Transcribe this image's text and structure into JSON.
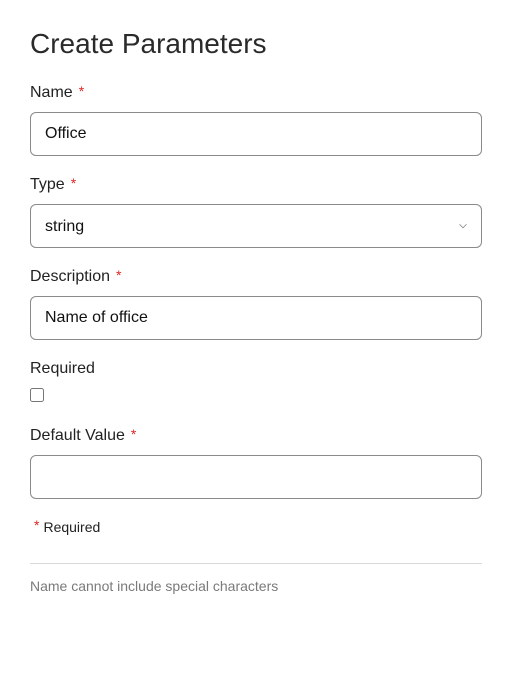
{
  "title": "Create Parameters",
  "required_marker": "*",
  "fields": {
    "name": {
      "label": "Name",
      "value": "Office",
      "required": true
    },
    "type": {
      "label": "Type",
      "value": "string",
      "required": true
    },
    "description": {
      "label": "Description",
      "value": "Name of office",
      "required": true
    },
    "required": {
      "label": "Required",
      "checked": false,
      "required": false
    },
    "default": {
      "label": "Default Value",
      "value": "",
      "required": true
    }
  },
  "legend": "Required",
  "hint": "Name cannot include special characters"
}
